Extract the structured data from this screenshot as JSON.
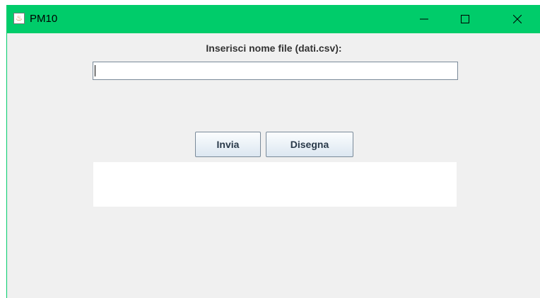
{
  "window": {
    "title": "PM10",
    "icon": "java-cup-icon",
    "accent_color": "#00cc6a",
    "controls": [
      "minimize-icon",
      "maximize-icon",
      "close-icon"
    ]
  },
  "form": {
    "prompt_label": "Inserisci nome file (dati.csv):",
    "filename_value": "",
    "send_label": "Invia",
    "draw_label": "Disegna",
    "output_text": ""
  }
}
